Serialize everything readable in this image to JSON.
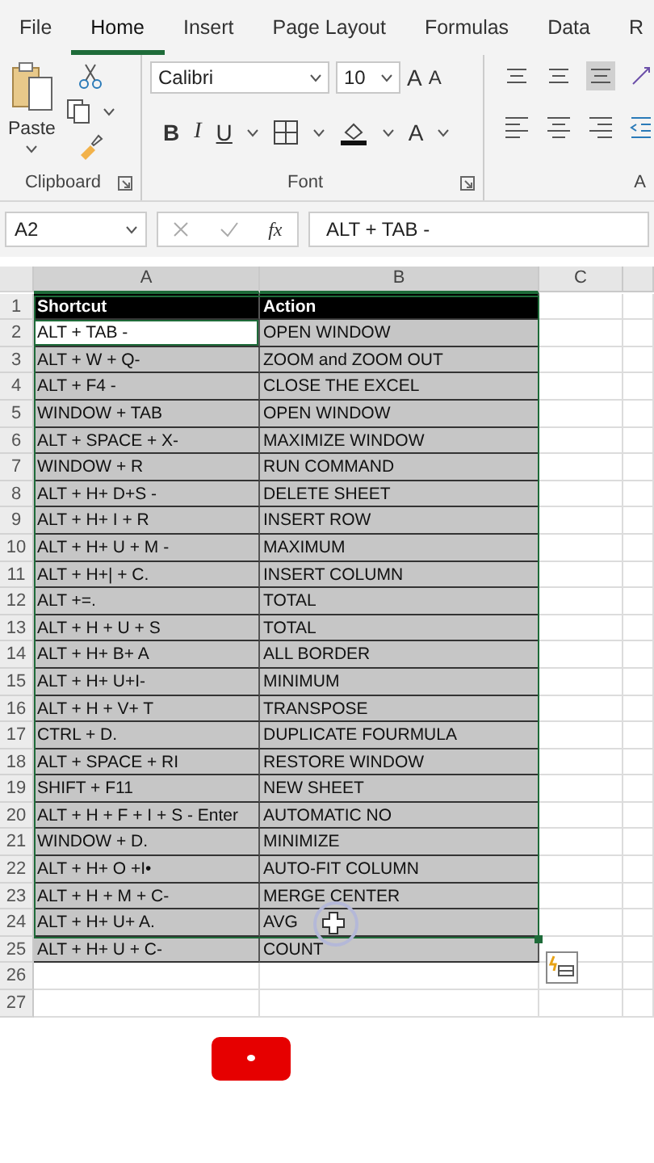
{
  "ribbon_tabs": [
    {
      "label": "File",
      "selected": false
    },
    {
      "label": "Home",
      "selected": true
    },
    {
      "label": "Insert",
      "selected": false
    },
    {
      "label": "Page Layout",
      "selected": false
    },
    {
      "label": "Formulas",
      "selected": false
    },
    {
      "label": "Data",
      "selected": false
    },
    {
      "label": "R",
      "selected": false
    }
  ],
  "clipboard": {
    "paste_label": "Paste",
    "group_label": "Clipboard"
  },
  "font": {
    "font_name": "Calibri",
    "font_size": "10",
    "grow_label": "A",
    "shrink_label": "A",
    "style_buttons": [
      "B",
      "I",
      "U"
    ],
    "color_label": "A",
    "group_label": "Font"
  },
  "alignment": {
    "group_label": "A"
  },
  "formula_bar": {
    "name_box": "A2",
    "fx_label": "fx",
    "formula": "ALT + TAB -"
  },
  "columns": [
    "A",
    "B",
    "C"
  ],
  "rows": [
    {
      "number": "1",
      "kind": "header",
      "active": false,
      "cells": [
        "Shortcut",
        "Action"
      ]
    },
    {
      "number": "2",
      "kind": "data",
      "active": true,
      "cells": [
        "ALT + TAB -",
        "OPEN WINDOW"
      ]
    },
    {
      "number": "3",
      "kind": "data",
      "active": false,
      "cells": [
        "ALT + W + Q-",
        "ZOOM and  ZOOM OUT"
      ]
    },
    {
      "number": "4",
      "kind": "data",
      "active": false,
      "cells": [
        "ALT + F4 -",
        "CLOSE THE EXCEL"
      ]
    },
    {
      "number": "5",
      "kind": "data",
      "active": false,
      "cells": [
        "WINDOW + TAB",
        "OPEN WINDOW"
      ]
    },
    {
      "number": "6",
      "kind": "data",
      "active": false,
      "cells": [
        "ALT + SPACE + X-",
        "MAXIMIZE WINDOW"
      ]
    },
    {
      "number": "7",
      "kind": "data",
      "active": false,
      "cells": [
        "WINDOW + R",
        "RUN COMMAND"
      ]
    },
    {
      "number": "8",
      "kind": "data",
      "active": false,
      "cells": [
        "ALT + H+ D+S -",
        "DELETE SHEET"
      ]
    },
    {
      "number": "9",
      "kind": "data",
      "active": false,
      "cells": [
        "ALT + H+ I + R",
        "INSERT ROW"
      ]
    },
    {
      "number": "10",
      "kind": "data",
      "active": false,
      "cells": [
        "ALT + H+ U + M -",
        "MAXIMUM"
      ]
    },
    {
      "number": "11",
      "kind": "data",
      "active": false,
      "cells": [
        "ALT + H+| + C.",
        "INSERT COLUMN"
      ]
    },
    {
      "number": "12",
      "kind": "data",
      "active": false,
      "cells": [
        "ALT +=.",
        "TOTAL"
      ]
    },
    {
      "number": "13",
      "kind": "data",
      "active": false,
      "cells": [
        "ALT + H + U + S",
        "TOTAL"
      ]
    },
    {
      "number": "14",
      "kind": "data",
      "active": false,
      "cells": [
        "ALT + H+ B+ A",
        "ALL BORDER"
      ]
    },
    {
      "number": "15",
      "kind": "data",
      "active": false,
      "cells": [
        "ALT + H+ U+I-",
        "MINIMUM"
      ]
    },
    {
      "number": "16",
      "kind": "data",
      "active": false,
      "cells": [
        "ALT + H + V+ T",
        "TRANSPOSE"
      ]
    },
    {
      "number": "17",
      "kind": "data",
      "active": false,
      "cells": [
        "CTRL + D.",
        "DUPLICATE FOURMULA"
      ]
    },
    {
      "number": "18",
      "kind": "data",
      "active": false,
      "cells": [
        "ALT + SPACE + RI",
        "RESTORE WINDOW"
      ]
    },
    {
      "number": "19",
      "kind": "data",
      "active": false,
      "cells": [
        "SHIFT + F11",
        "NEW SHEET"
      ]
    },
    {
      "number": "20",
      "kind": "data",
      "active": false,
      "cells": [
        "ALT + H + F + I + S - Enter",
        "AUTOMATIC NO"
      ]
    },
    {
      "number": "21",
      "kind": "data",
      "active": false,
      "cells": [
        "WINDOW + D.",
        "MINIMIZE"
      ]
    },
    {
      "number": "22",
      "kind": "data",
      "active": false,
      "cells": [
        "ALT + H+ O +I•",
        "AUTO-FIT COLUMN"
      ]
    },
    {
      "number": "23",
      "kind": "data",
      "active": false,
      "cells": [
        "ALT + H + M + C-",
        "MERGE CENTER"
      ]
    },
    {
      "number": "24",
      "kind": "data",
      "active": false,
      "cells": [
        "ALT + H+ U+ A.",
        "AVG"
      ]
    },
    {
      "number": "25",
      "kind": "data",
      "active": false,
      "cells": [
        "ALT + H+ U + C-",
        "COUNT"
      ]
    },
    {
      "number": "26",
      "kind": "empty",
      "active": false,
      "cells": []
    },
    {
      "number": "27",
      "kind": "empty",
      "active": false,
      "cells": []
    }
  ]
}
